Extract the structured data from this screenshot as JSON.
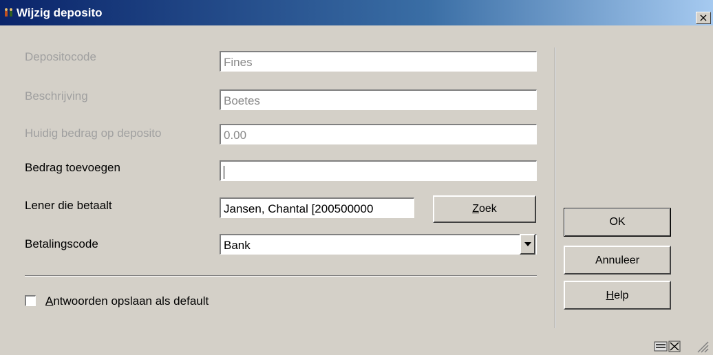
{
  "window": {
    "title": "Wijzig deposito",
    "close_label": "×"
  },
  "form": {
    "depositocode": {
      "label": "Depositocode",
      "value": "Fines"
    },
    "beschrijving": {
      "label": "Beschrijving",
      "value": "Boetes"
    },
    "huidig_bedrag": {
      "label": "Huidig bedrag op deposito",
      "value": "0.00"
    },
    "bedrag_toevoegen": {
      "label": "Bedrag toevoegen",
      "value": ""
    },
    "lener": {
      "label": "Lener die betaalt",
      "value": "Jansen, Chantal [200500000",
      "search_button_rest": "oek",
      "search_button_mnemonic": "Z"
    },
    "betalingscode": {
      "label": "Betalingscode",
      "value": "Bank"
    },
    "checkbox": {
      "mnemonic": "A",
      "label_rest": "ntwoorden opslaan als default",
      "checked": false
    }
  },
  "buttons": {
    "ok": "OK",
    "annuleer": "Annuleer",
    "help_mnemonic": "H",
    "help_rest": "elp"
  },
  "icons": [
    "app-icon",
    "keyboard-icon",
    "fullscreen-icon",
    "resize-grip-icon"
  ]
}
